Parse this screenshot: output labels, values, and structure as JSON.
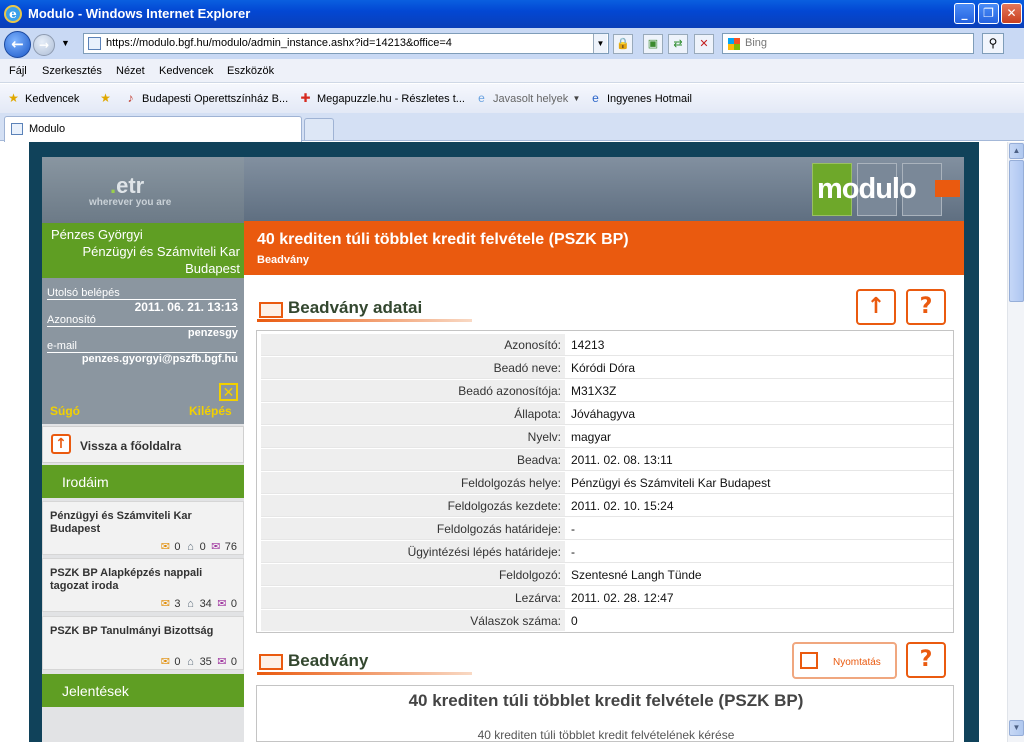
{
  "window": {
    "title": "Modulo - Windows Internet Explorer"
  },
  "address": {
    "url": "https://modulo.bgf.hu/modulo/admin_instance.ashx?id=14213&office=4",
    "search_placeholder": "Bing"
  },
  "menu": [
    "Fájl",
    "Szerkesztés",
    "Nézet",
    "Kedvencek",
    "Eszközök"
  ],
  "favorites": {
    "label": "Kedvencek",
    "items": [
      "Budapesti Operettszínház B...",
      "Megapuzzle.hu - Részletes t...",
      "Javasolt helyek",
      "Ingyenes Hotmail"
    ]
  },
  "tab": {
    "title": "Modulo"
  },
  "logo": {
    "etr": "etr",
    "dot": ".",
    "tagline": "wherever you are",
    "modulo": "modulo"
  },
  "user": {
    "name": "Pénzes Györgyi",
    "faculty_line1": "Pénzügyi és Számviteli Kar",
    "faculty_line2": "Budapest"
  },
  "info": {
    "last_login_label": "Utolsó belépés",
    "last_login": "2011. 06. 21. 13:13",
    "id_label": "Azonosító",
    "id": "penzesgy",
    "email_label": "e-mail",
    "email": "penzes.gyorgyi@pszfb.bgf.hu",
    "help": "Súgó",
    "logout": "Kilépés"
  },
  "back": {
    "label": "Vissza a főoldalra"
  },
  "offices": {
    "header": "Irodáim",
    "items": [
      {
        "name": "Pénzügyi és Számviteli Kar Budapest",
        "c1": "0",
        "c2": "0",
        "c3": "76"
      },
      {
        "name": "PSZK BP Alapképzés nappali tagozat iroda",
        "c1": "3",
        "c2": "34",
        "c3": "0"
      },
      {
        "name": "PSZK BP Tanulmányi Bizottság",
        "c1": "0",
        "c2": "35",
        "c3": "0"
      }
    ]
  },
  "reports": {
    "header": "Jelentések"
  },
  "page": {
    "title": "40 krediten túli többlet kredit felvétele (PSZK BP)",
    "subtitle": "Beadvány"
  },
  "section1": {
    "title": "Beadvány adatai",
    "up_icon": "arrow-up-icon",
    "help_icon": "question-icon"
  },
  "details": [
    {
      "k": "Azonosító:",
      "v": "14213"
    },
    {
      "k": "Beadó neve:",
      "v": "Kóródi Dóra"
    },
    {
      "k": "Beadó azonosítója:",
      "v": "M31X3Z"
    },
    {
      "k": "Állapota:",
      "v": "Jóváhagyva"
    },
    {
      "k": "Nyelv:",
      "v": "magyar"
    },
    {
      "k": "Beadva:",
      "v": "2011. 02. 08. 13:11"
    },
    {
      "k": "Feldolgozás helye:",
      "v": "Pénzügyi és Számviteli Kar Budapest"
    },
    {
      "k": "Feldolgozás kezdete:",
      "v": "2011. 02. 10. 15:24"
    },
    {
      "k": "Feldolgozás határideje:",
      "v": "-"
    },
    {
      "k": "Ügyintézési lépés határideje:",
      "v": "-"
    },
    {
      "k": "Feldolgozó:",
      "v": "Szentesné Langh Tünde"
    },
    {
      "k": "Lezárva:",
      "v": "2011. 02. 28. 12:47"
    },
    {
      "k": "Válaszok száma:",
      "v": "0"
    }
  ],
  "section2": {
    "title": "Beadvány",
    "print_label": "Nyomtatás"
  },
  "submission": {
    "heading": "40 krediten túli többlet kredit felvétele (PSZK BP)",
    "sub": "40 krediten túli többlet kredit felvételének kérése"
  },
  "colors": {
    "accent": "#ea5a0f",
    "green": "#5f9e23",
    "dark": "#10425a"
  }
}
